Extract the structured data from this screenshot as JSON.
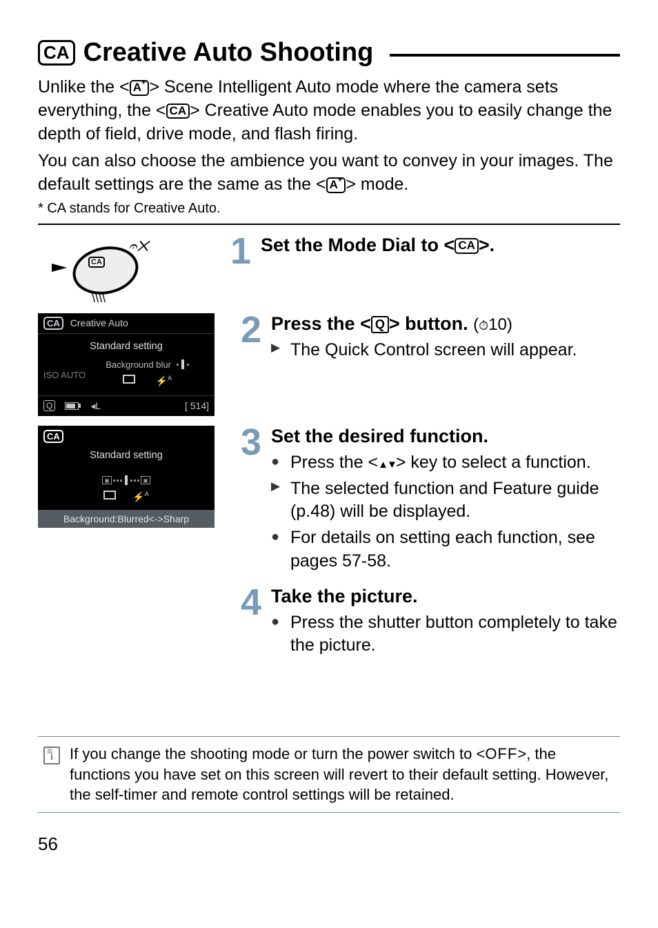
{
  "heading": {
    "icon_label": "CA",
    "title": "Creative Auto Shooting"
  },
  "intro": {
    "line1_a": "Unlike the <",
    "line1_b": "> Scene Intelligent Auto mode where the camera sets everything, the <",
    "line1_c": "> Creative Auto mode enables you to easily change the depth of field, drive mode, and flash firing.",
    "line2": "You can also choose the ambience you want to convey in your images. The default settings are the same as the <",
    "line2_b": "> mode.",
    "footnote": "* CA stands for Creative Auto.",
    "ca_label": "CA"
  },
  "dial": {
    "ca": "CA"
  },
  "step1": {
    "title_a": "Set the Mode Dial to <",
    "title_b": ">.",
    "ca_label": "CA"
  },
  "step2": {
    "title_a": "Press the <",
    "title_b": "> button.",
    "timer": "10",
    "bullet1": "The Quick Control screen will appear.",
    "q_label": "Q"
  },
  "lcd1": {
    "ca": "CA",
    "header": "Creative Auto",
    "standard": "Standard setting",
    "bg_blur": "Background blur",
    "iso_auto": "ISO AUTO",
    "shots": "[  514]",
    "q": "Q",
    "quality": "◂L"
  },
  "step3": {
    "title": "Set the desired function.",
    "b1_a": "Press the <",
    "b1_b": "> key to select a function.",
    "b2": "The selected function and Feature guide (p.48) will be displayed.",
    "b3": "For details on setting each function, see pages 57-58."
  },
  "lcd2": {
    "ca": "CA",
    "standard": "Standard setting",
    "footer": "Background:Blurred<->Sharp"
  },
  "step4": {
    "title": "Take the picture.",
    "b1": "Press the shutter button completely to take the picture."
  },
  "note": {
    "text_a": "If you change the shooting mode or turn the power switch to <",
    "off": "OFF",
    "text_b": ">, the functions you have set on this screen will revert to their default setting. However, the self-timer and remote control settings will be retained."
  },
  "page": "56"
}
